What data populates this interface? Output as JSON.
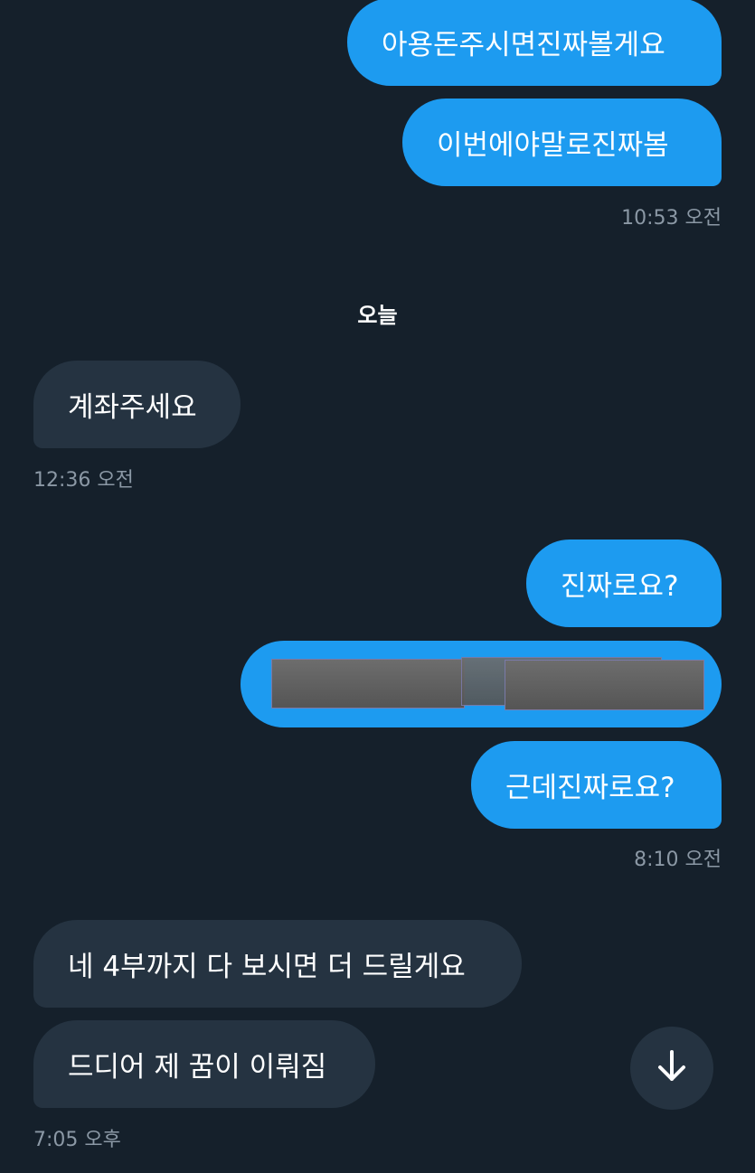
{
  "messages": {
    "m1": "아용돈주시면진짜볼게요",
    "m2": "이번에야말로진짜봄",
    "m3": "계좌주세요",
    "m4": "진짜로요?",
    "m5": "근데진짜로요?",
    "m6": "네 4부까지 다 보시면 더 드릴게요",
    "m7": "드디어 제 꿈이 이뤄짐"
  },
  "timestamps": {
    "t1": "10:53 오전",
    "t2": "12:36 오전",
    "t3": "8:10 오전",
    "t4": "7:05 오후"
  },
  "day_separator": "오늘",
  "icons": {
    "scroll_down": "arrow-down-icon",
    "image": "image-attachment"
  },
  "colors": {
    "background": "#15202b",
    "sent_bubble": "#1d9bf0",
    "received_bubble": "#253341",
    "timestamp_text": "#8b98a5"
  }
}
